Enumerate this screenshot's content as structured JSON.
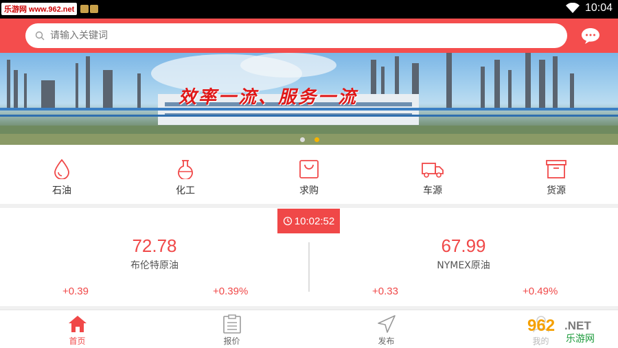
{
  "status_bar": {
    "watermark": "乐游网 www.962.net",
    "time": "10:04"
  },
  "search": {
    "placeholder": "请输入关键词"
  },
  "banner": {
    "slogan": "效率一流、服务一流"
  },
  "categories": [
    {
      "label": "石油",
      "icon": "oil-drop-icon"
    },
    {
      "label": "化工",
      "icon": "flask-icon"
    },
    {
      "label": "求购",
      "icon": "shopping-bag-icon"
    },
    {
      "label": "车源",
      "icon": "truck-icon"
    },
    {
      "label": "货源",
      "icon": "cargo-box-icon"
    }
  ],
  "market": {
    "time": "10:02:52",
    "quotes": [
      {
        "price": "72.78",
        "name": "布伦特原油",
        "change": "+0.39",
        "percent": "+0.39%"
      },
      {
        "price": "67.99",
        "name": "NYMEX原油",
        "change": "+0.33",
        "percent": "+0.49%"
      }
    ]
  },
  "tabs": [
    {
      "label": "首页",
      "icon": "home-icon",
      "active": true
    },
    {
      "label": "报价",
      "icon": "clipboard-icon"
    },
    {
      "label": "发布",
      "icon": "send-icon"
    },
    {
      "label": "我的",
      "icon": "user-icon"
    }
  ],
  "watermark_logo": {
    "number": "962",
    "suffix": ".NET",
    "text": "乐游网"
  },
  "colors": {
    "accent": "#f04848",
    "header": "#f44d4d",
    "highlight_dot": "#f5b300"
  }
}
